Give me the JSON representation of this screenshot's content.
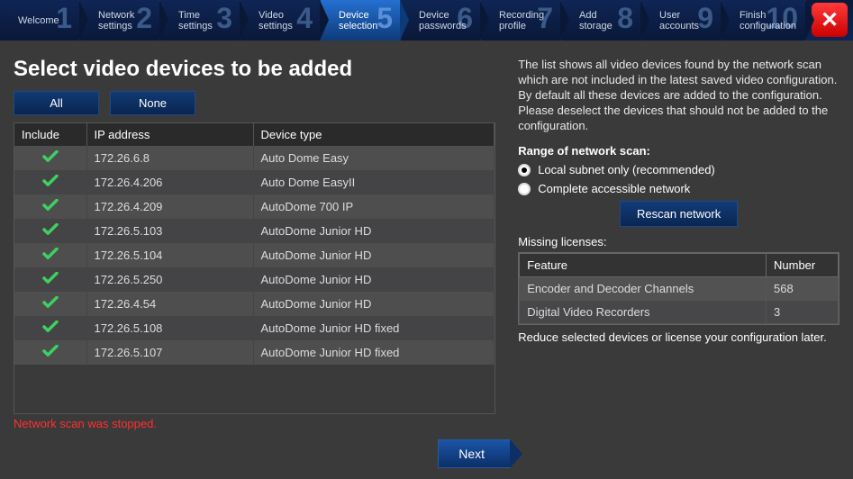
{
  "steps": [
    {
      "num": "1",
      "label": "Welcome"
    },
    {
      "num": "2",
      "label": "Network\nsettings"
    },
    {
      "num": "3",
      "label": "Time\nsettings"
    },
    {
      "num": "4",
      "label": "Video\nsettings"
    },
    {
      "num": "5",
      "label": "Device\nselection"
    },
    {
      "num": "6",
      "label": "Device\npasswords"
    },
    {
      "num": "7",
      "label": "Recording\nprofile"
    },
    {
      "num": "8",
      "label": "Add\nstorage"
    },
    {
      "num": "9",
      "label": "User\naccounts"
    },
    {
      "num": "10",
      "label": "Finish\nconfiguration"
    }
  ],
  "active_step": 4,
  "title": "Select video devices to be added",
  "buttons": {
    "all": "All",
    "none": "None",
    "next": "Next",
    "rescan": "Rescan network"
  },
  "table": {
    "headers": {
      "include": "Include",
      "ip": "IP address",
      "type": "Device type"
    },
    "rows": [
      {
        "ip": "172.26.6.8",
        "type": "Auto Dome Easy"
      },
      {
        "ip": "172.26.4.206",
        "type": "Auto Dome EasyII"
      },
      {
        "ip": "172.26.4.209",
        "type": "AutoDome 700 IP"
      },
      {
        "ip": "172.26.5.103",
        "type": "AutoDome Junior HD"
      },
      {
        "ip": "172.26.5.104",
        "type": "AutoDome Junior HD"
      },
      {
        "ip": "172.26.5.250",
        "type": "AutoDome Junior HD"
      },
      {
        "ip": "172.26.4.54",
        "type": "AutoDome Junior HD"
      },
      {
        "ip": "172.26.5.108",
        "type": "AutoDome Junior HD fixed"
      },
      {
        "ip": "172.26.5.107",
        "type": "AutoDome Junior HD fixed"
      }
    ]
  },
  "status": "Network scan was stopped.",
  "info": "The list shows all video devices found by the network scan which are not included in the latest saved video configuration.\nBy default all these devices are added to the configuration.\nPlease deselect the devices that should not be added to the configuration.",
  "range": {
    "title": "Range of network scan:",
    "opt1": "Local subnet only (recommended)",
    "opt2": "Complete accessible network",
    "selected": 0
  },
  "licenses": {
    "title": "Missing licenses:",
    "headers": {
      "feature": "Feature",
      "number": "Number"
    },
    "rows": [
      {
        "feature": "Encoder and Decoder Channels",
        "number": "568"
      },
      {
        "feature": "Digital Video Recorders",
        "number": "3"
      }
    ],
    "note": "Reduce selected devices or license your configuration later."
  }
}
